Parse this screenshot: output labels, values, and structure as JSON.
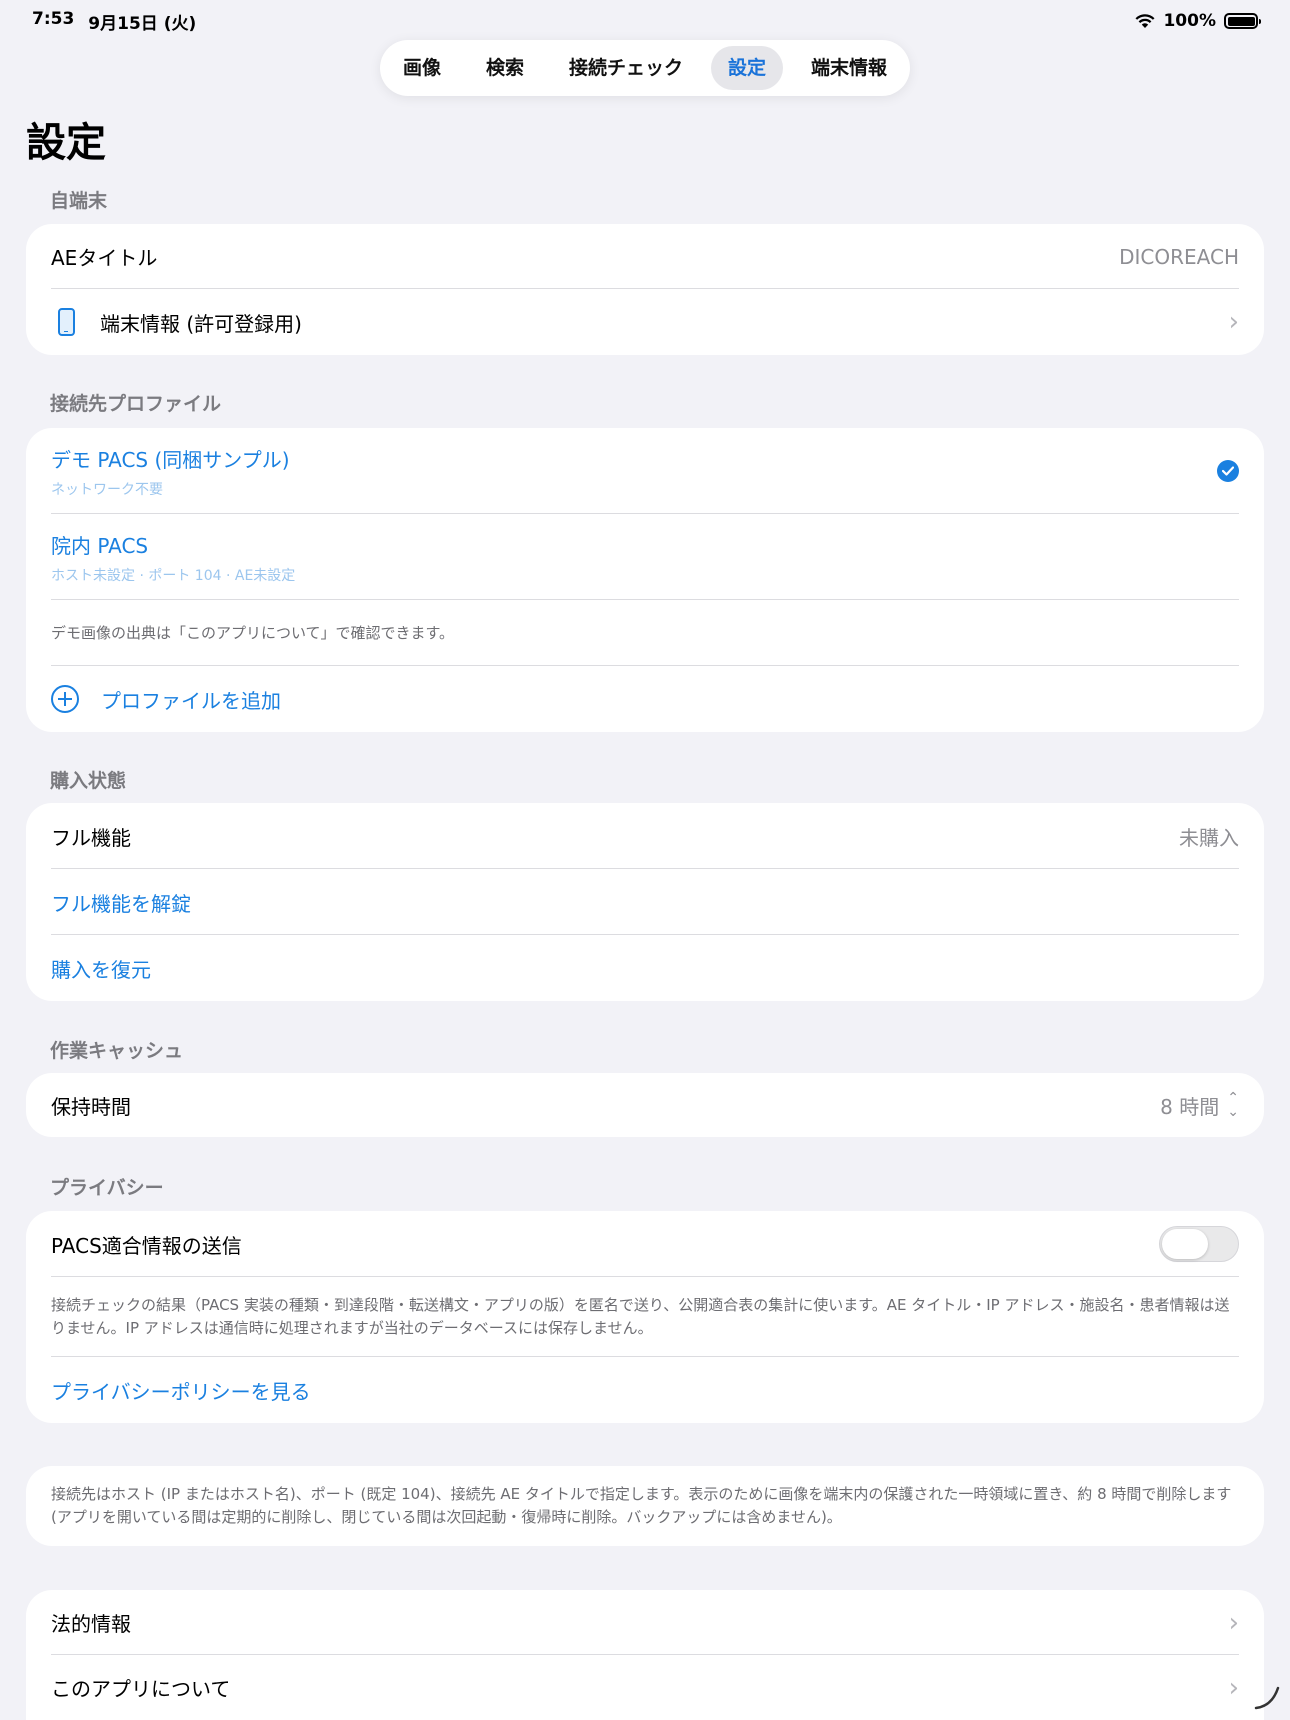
{
  "status_bar": {
    "time": "7:53",
    "date": "9月15日 (火)",
    "battery": "100%"
  },
  "tabs": [
    {
      "label": "画像",
      "active": false
    },
    {
      "label": "検索",
      "active": false
    },
    {
      "label": "接続チェック",
      "active": false
    },
    {
      "label": "設定",
      "active": true
    },
    {
      "label": "端末情報",
      "active": false
    }
  ],
  "page_title": "設定",
  "device_section": {
    "header": "自端末",
    "ae_title_label": "AEタイトル",
    "ae_title_value": "DICOREACH",
    "device_info_label": "端末情報 (許可登録用)"
  },
  "profiles_section": {
    "header": "接続先プロファイル",
    "profiles": [
      {
        "name": "デモ PACS (同梱サンプル)",
        "detail": "ネットワーク不要",
        "selected": true
      },
      {
        "name": "院内 PACS",
        "detail": "ホスト未設定 · ポート 104 · AE未設定",
        "selected": false
      }
    ],
    "note": "デモ画像の出典は「このアプリについて」で確認できます。",
    "add_label": "プロファイルを追加"
  },
  "purchase_section": {
    "header": "購入状態",
    "full_label": "フル機能",
    "full_value": "未購入",
    "unlock_label": "フル機能を解錠",
    "restore_label": "購入を復元"
  },
  "cache_section": {
    "header": "作業キャッシュ",
    "retention_label": "保持時間",
    "retention_value": "8 時間"
  },
  "privacy_section": {
    "header": "プライバシー",
    "send_label": "PACS適合情報の送信",
    "send_enabled": false,
    "note": "接続チェックの結果（PACS 実装の種類・到達段階・転送構文・アプリの版）を匿名で送り、公開適合表の集計に使います。AE タイトル・IP アドレス・施設名・患者情報は送りません。IP アドレスは通信時に処理されますが当社のデータベースには保存しません。",
    "policy_label": "プライバシーポリシーを見る"
  },
  "info_note": "接続先はホスト (IP またはホスト名)、ポート (既定 104)、接続先 AE タイトルで指定します。表示のために画像を端末内の保護された一時領域に置き、約 8 時間で削除します (アプリを開いている間は定期的に削除し、閉じている間は次回起動・復帰時に削除。バックアップには含めません)。",
  "legal_section": {
    "legal_label": "法的情報",
    "about_label": "このアプリについて"
  },
  "colors": {
    "accent": "#1a80e0",
    "background": "#f2f2f7",
    "card": "#ffffff"
  }
}
